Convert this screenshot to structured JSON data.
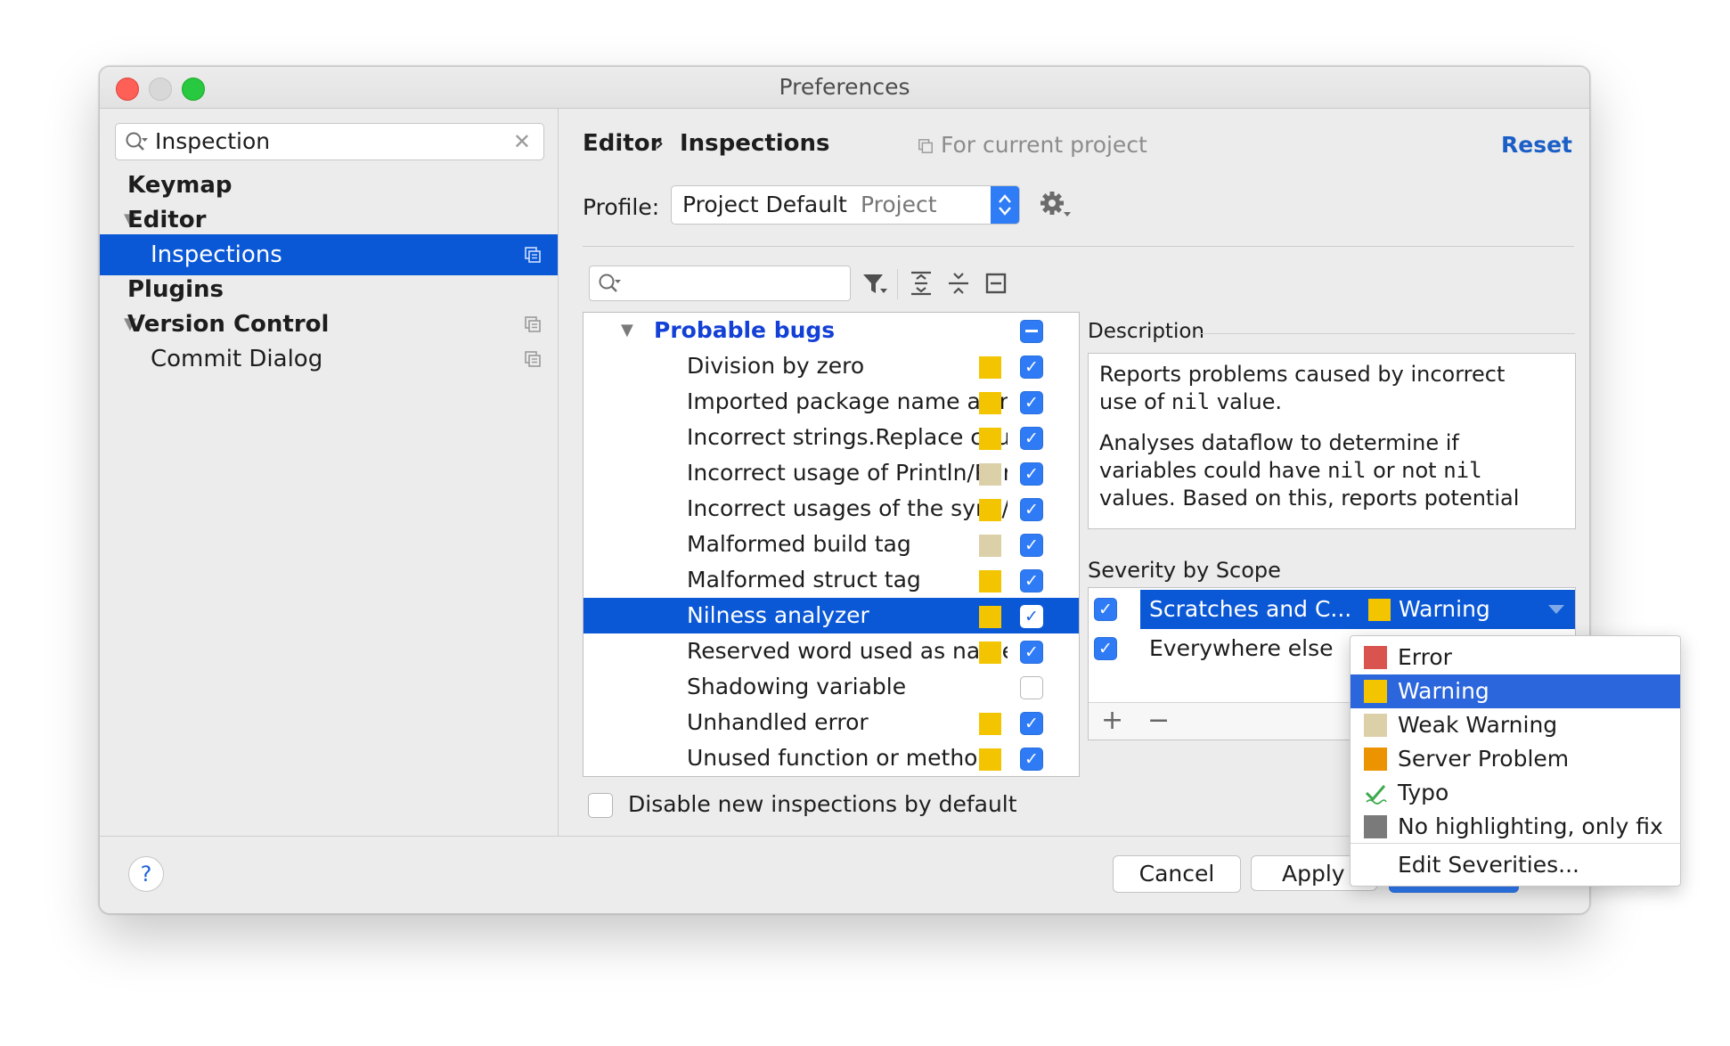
{
  "window": {
    "title": "Preferences"
  },
  "sidebar": {
    "search_value": "Inspection",
    "items": [
      {
        "label": "Keymap",
        "bold": true
      },
      {
        "label": "Editor",
        "bold": true,
        "expanded": true
      },
      {
        "label": "Inspections",
        "selected": true
      },
      {
        "label": "Plugins",
        "bold": true
      },
      {
        "label": "Version Control",
        "bold": true,
        "expanded": true
      },
      {
        "label": "Commit Dialog"
      }
    ]
  },
  "header": {
    "breadcrumb": [
      "Editor",
      "›",
      "Inspections"
    ],
    "for_project": "For current project",
    "reset": "Reset"
  },
  "profile": {
    "label": "Profile:",
    "value": "Project Default",
    "kind": "Project"
  },
  "inspections": {
    "group": "Probable bugs",
    "items": [
      {
        "name": "Division by zero",
        "severity": "warning",
        "checked": true
      },
      {
        "name": "Imported package name as name identifier",
        "severity": "warning",
        "checked": true
      },
      {
        "name": "Incorrect strings.Replace count argument",
        "severity": "warning",
        "checked": true
      },
      {
        "name": "Incorrect usage of Println/Printf-like functions",
        "severity": "weak",
        "checked": true
      },
      {
        "name": "Incorrect usages of the sync/atomic package",
        "severity": "warning",
        "checked": true
      },
      {
        "name": "Malformed build tag",
        "severity": "weak",
        "checked": true
      },
      {
        "name": "Malformed struct tag",
        "severity": "warning",
        "checked": true
      },
      {
        "name": "Nilness analyzer",
        "severity": "warning",
        "checked": true,
        "selected": true
      },
      {
        "name": "Reserved word used as name",
        "severity": "warning",
        "checked": true
      },
      {
        "name": "Shadowing variable",
        "severity": "none",
        "checked": false
      },
      {
        "name": "Unhandled error",
        "severity": "warning",
        "checked": true
      },
      {
        "name": "Unused function or method",
        "severity": "warning",
        "checked": true
      }
    ]
  },
  "disable_new": "Disable new inspections by default",
  "description": {
    "title": "Description",
    "lines": [
      [
        "Reports problems caused by incorrect"
      ],
      [
        "use of ",
        "nil",
        " value."
      ],
      [],
      [
        "Analyses dataflow to determine if"
      ],
      [
        "variables could have ",
        "nil",
        " or not ",
        "nil"
      ],
      [
        "values. Based on this, reports potential"
      ]
    ]
  },
  "severity_scope": {
    "title": "Severity by Scope",
    "rows": [
      {
        "scope": "Scratches and C...",
        "severity": "Warning",
        "selected": true
      },
      {
        "scope": "Everywhere else"
      }
    ],
    "add": "+",
    "remove": "−"
  },
  "buttons": {
    "help": "?",
    "cancel": "Cancel",
    "apply": "Apply"
  },
  "severity_menu": [
    {
      "label": "Error",
      "icon": "error-swatch"
    },
    {
      "label": "Warning",
      "icon": "warning-swatch",
      "selected": true
    },
    {
      "label": "Weak Warning",
      "icon": "weak-warning-swatch"
    },
    {
      "label": "Server Problem",
      "icon": "server-problem-swatch"
    },
    {
      "label": "Typo",
      "icon": "typo-check-icon"
    },
    {
      "label": "No highlighting, only fix",
      "icon": "no-highlighting-swatch"
    },
    {
      "label": "Edit Severities..."
    }
  ],
  "colors": {
    "accent": "#0b58d6",
    "link": "#1b5fc6",
    "warning": "#f2c500",
    "weak_warning": "#dcd0a8",
    "error": "#d9534f",
    "server_problem": "#ec9300",
    "typo": "#3eaa4c",
    "no_highlighting": "#7a7a7a"
  }
}
